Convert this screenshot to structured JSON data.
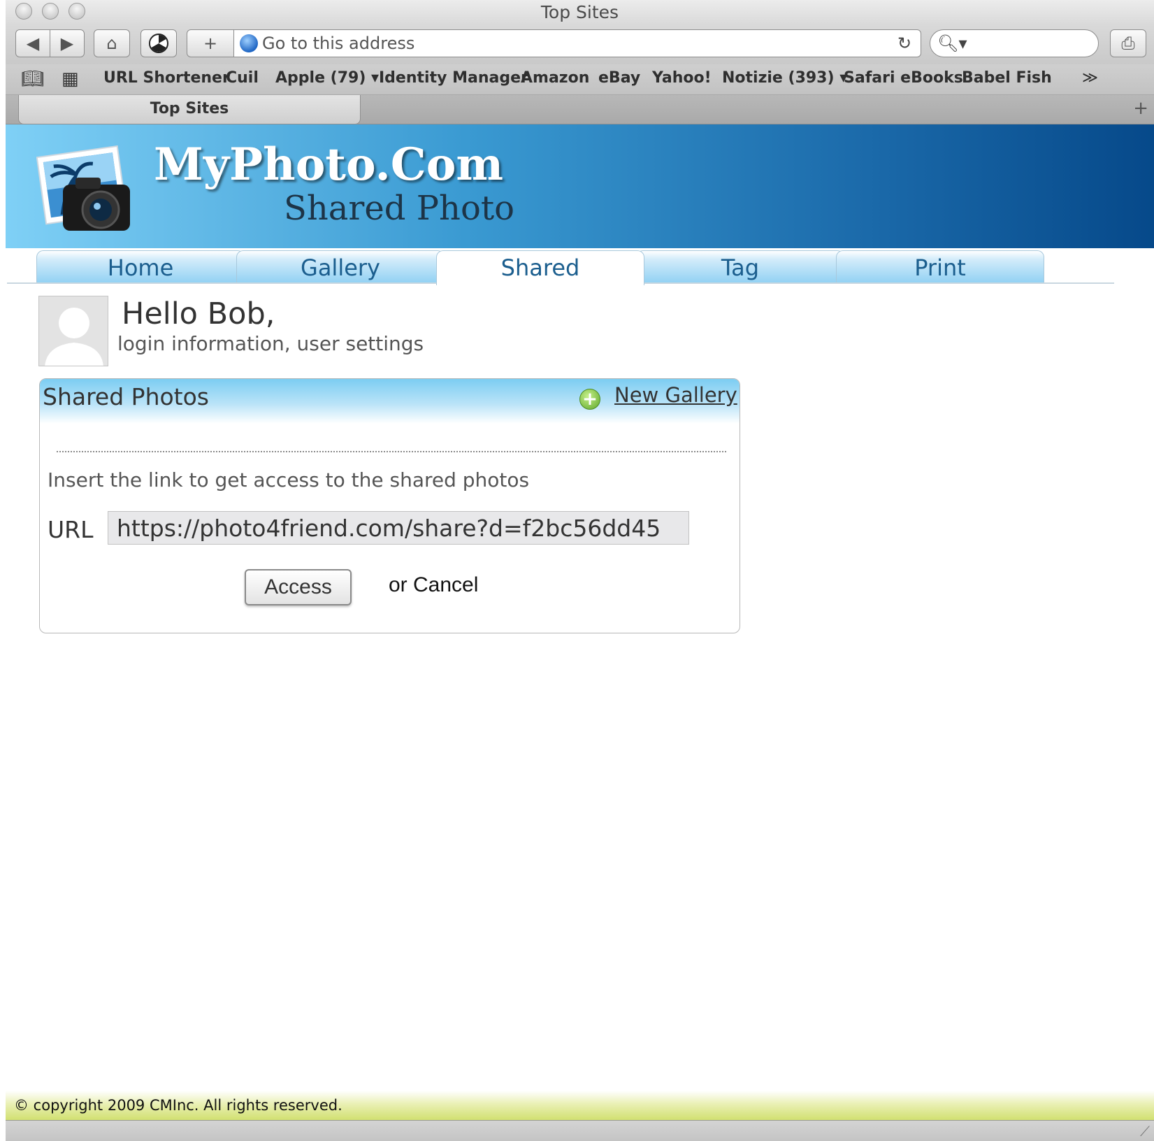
{
  "window": {
    "title": "Top Sites"
  },
  "toolbar": {
    "back_icon": "back-arrow-icon",
    "forward_icon": "forward-arrow-icon",
    "home_icon": "home-icon",
    "add_label": "+",
    "address_placeholder": "Go to this address",
    "reload_icon": "reload-icon",
    "search_icon": "magnifier-icon",
    "print_icon": "printer-icon"
  },
  "bookmarks": {
    "items": [
      {
        "label": "URL Shortener"
      },
      {
        "label": "Cuil"
      },
      {
        "label": "Apple (79) ▾"
      },
      {
        "label": "Identity Manager"
      },
      {
        "label": "Amazon"
      },
      {
        "label": "eBay"
      },
      {
        "label": "Yahoo!"
      },
      {
        "label": "Notizie (393) ▾"
      },
      {
        "label": "Safari eBooks"
      },
      {
        "label": "Babel Fish"
      }
    ],
    "overflow": "≫"
  },
  "tabs": {
    "active": "Top Sites"
  },
  "site": {
    "brand": "MyPhoto.Com",
    "tagline": "Shared Photo",
    "accent_color": "#1b5e8e"
  },
  "nav": {
    "tabs": [
      {
        "label": "Home"
      },
      {
        "label": "Gallery"
      },
      {
        "label": "Shared",
        "active": true
      },
      {
        "label": "Tag"
      },
      {
        "label": "Print"
      }
    ]
  },
  "user": {
    "greeting": "Hello Bob,",
    "subtitle": "login information, user settings"
  },
  "panel": {
    "title": "Shared Photos",
    "new_gallery_label": "New Gallery",
    "instructions": "Insert the link to get access to the shared photos",
    "url_label": "URL",
    "url_value": "https://photo4friend.com/share?d=f2bc56dd45",
    "access_label": "Access",
    "cancel_label": "or Cancel"
  },
  "footer": {
    "copyright": "© copyright 2009 CMInc. All rights reserved."
  }
}
